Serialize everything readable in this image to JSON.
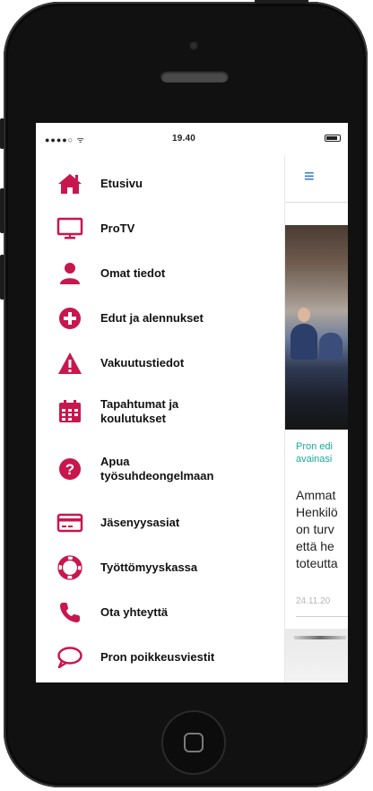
{
  "status_bar": {
    "signal": "●●●●○ ᯤ",
    "time": "19.40"
  },
  "menu": {
    "items": [
      {
        "label": "Etusivu",
        "icon": "home-icon"
      },
      {
        "label": "ProTV",
        "icon": "tv-monitor-icon"
      },
      {
        "label": "Omat tiedot",
        "icon": "person-icon"
      },
      {
        "label": "Edut ja alennukset",
        "icon": "plus-circle-icon"
      },
      {
        "label": "Vakuutustiedot",
        "icon": "warning-triangle-icon"
      },
      {
        "label": "Tapahtumat ja koulutukset",
        "line1": "Tapahtumat ja",
        "line2": "koulutukset",
        "icon": "calendar-icon"
      },
      {
        "label": "Apua työsuhdeongelmaan",
        "line1": "Apua",
        "line2": "työsuhdeongelmaan",
        "icon": "question-circle-icon"
      },
      {
        "label": "Jäsenyysasiat",
        "icon": "card-icon"
      },
      {
        "label": "Työttömyyskassa",
        "icon": "lifebuoy-icon"
      },
      {
        "label": "Ota yhteyttä",
        "icon": "phone-icon"
      },
      {
        "label": "Pron poikkeusviestit",
        "icon": "speech-bubble-icon"
      }
    ]
  },
  "content": {
    "menu_icon": "≡",
    "teal_line1": "Pron edi",
    "teal_line2": "avainasi",
    "body_lines": [
      "Ammat",
      "Henkilö",
      "on turv",
      "että he",
      "toteutta"
    ],
    "date": "24.11.20"
  },
  "colors": {
    "accent": "#c8174e",
    "link": "#1f6fc7",
    "teal": "#1aa99a"
  }
}
